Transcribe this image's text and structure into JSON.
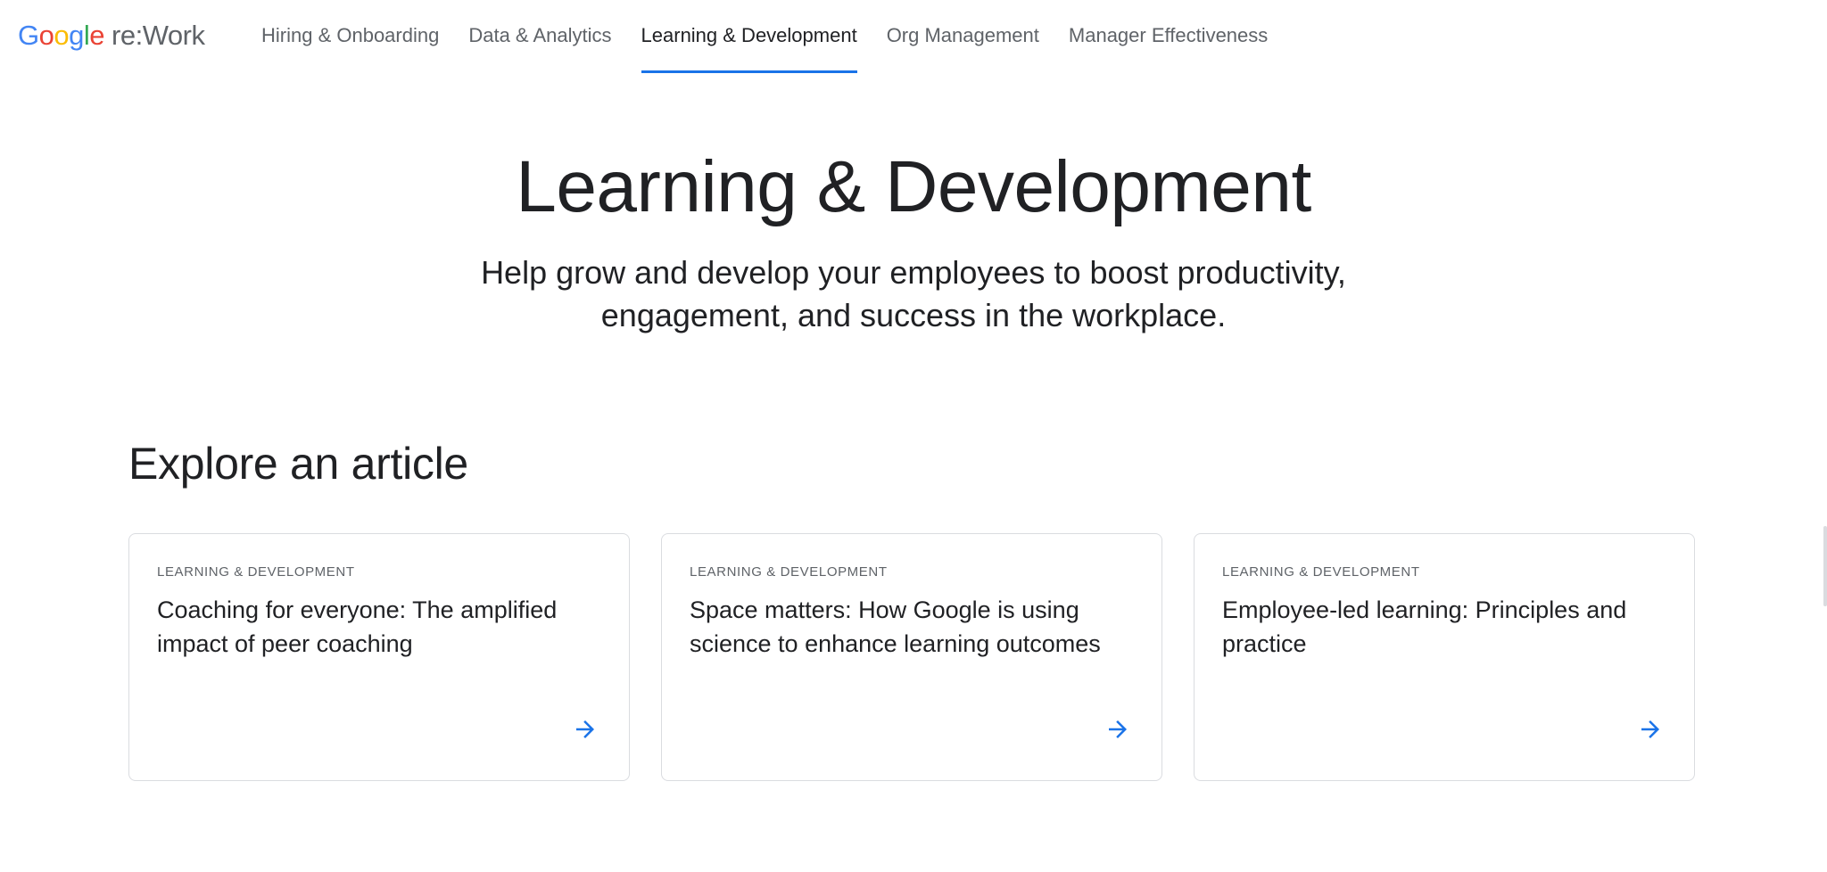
{
  "header": {
    "logo": {
      "brand_letters": [
        "G",
        "o",
        "o",
        "g",
        "l",
        "e"
      ],
      "product": "re:Work"
    },
    "nav": [
      {
        "label": "Hiring & Onboarding",
        "active": false
      },
      {
        "label": "Data & Analytics",
        "active": false
      },
      {
        "label": "Learning & Development",
        "active": true
      },
      {
        "label": "Org Management",
        "active": false
      },
      {
        "label": "Manager Effectiveness",
        "active": false
      }
    ]
  },
  "hero": {
    "title": "Learning & Development",
    "subtitle": "Help grow and develop your employees to boost productivity, engagement, and success in the workplace."
  },
  "section": {
    "title": "Explore an article",
    "cards": [
      {
        "eyebrow": "Learning & Development",
        "title": "Coaching for everyone: The amplified impact of peer coaching",
        "icon": "arrow-right-icon"
      },
      {
        "eyebrow": "Learning & Development",
        "title": "Space matters: How Google is using science to enhance learning outcomes",
        "icon": "arrow-right-icon"
      },
      {
        "eyebrow": "Learning & Development",
        "title": "Employee-led learning: Principles and practice",
        "icon": "arrow-right-icon"
      }
    ]
  },
  "colors": {
    "accent": "#1a73e8",
    "text_primary": "#202124",
    "text_secondary": "#5f6368",
    "border": "#dadce0"
  }
}
